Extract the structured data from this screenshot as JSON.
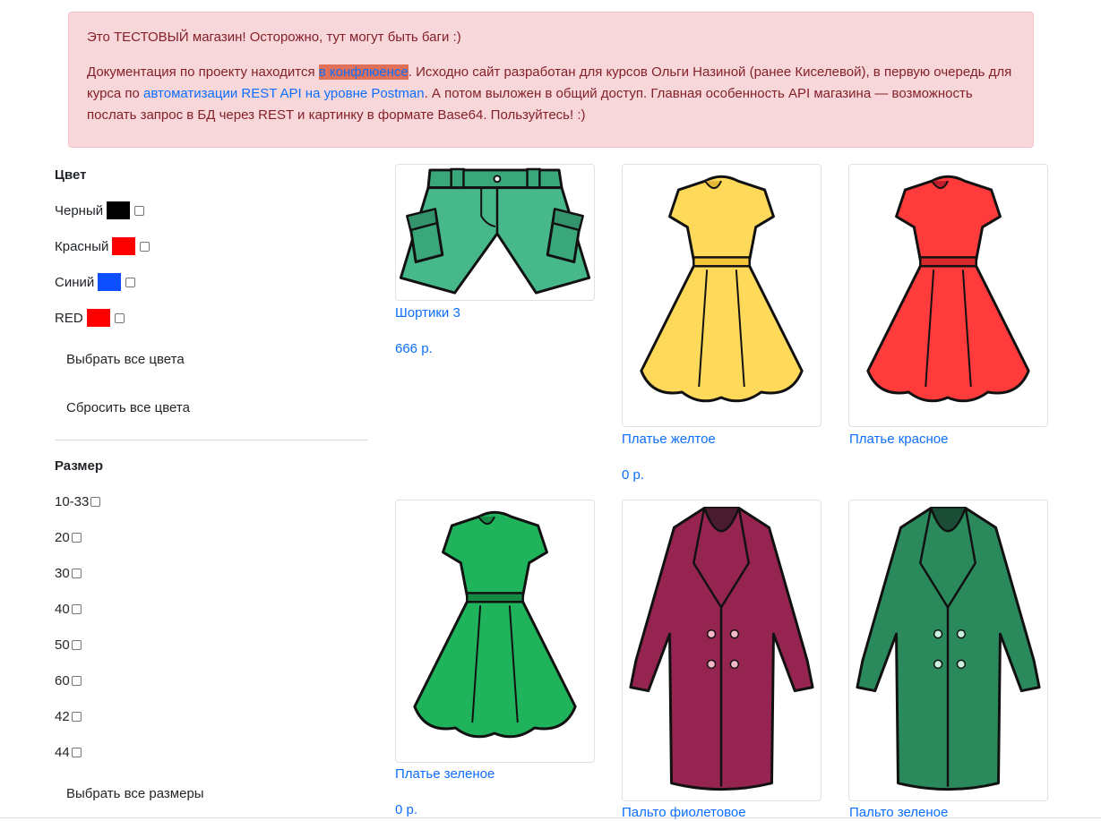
{
  "notice": {
    "line1": "Это ТЕСТОВЫЙ магазин! Осторожно, тут могут быть баги :)",
    "doc_before": "Документация по проекту находится ",
    "doc_link": "в конфлюенсе",
    "doc_middle1": ".  Исходно сайт разработан для курсов Ольги Назиной (ранее Киселевой), в первую очередь для курса по ",
    "doc_link2": "автоматизации REST API на уровне Postman",
    "doc_middle2": ". А потом выложен в общий доступ. Главная особенность API магазина — возможность послать запрос в БД через REST и картинку в формате Base64.  Пользуйтесь! :)"
  },
  "filters": {
    "color_heading": "Цвет",
    "colors": [
      {
        "label": "Черный",
        "swatch": "#000000"
      },
      {
        "label": "Красный",
        "swatch": "#ff0000"
      },
      {
        "label": "Синий",
        "swatch": "#0d4fff"
      },
      {
        "label": "RED",
        "swatch": "#ff0000"
      }
    ],
    "select_all_colors": "Выбрать все цвета",
    "reset_all_colors": "Сбросить все цвета",
    "size_heading": "Размер",
    "sizes": [
      "10-33",
      "20",
      "30",
      "40",
      "50",
      "60",
      "42",
      "44"
    ],
    "select_all_sizes": "Выбрать все размеры"
  },
  "products": [
    {
      "name": "Шортики 3",
      "price": "666 р.",
      "image": "shorts-icon",
      "color": "#47b88a"
    },
    {
      "name": "Платье желтое",
      "price": "0 р.",
      "image": "dress-icon",
      "color": "#ffd95a"
    },
    {
      "name": "Платье красное",
      "price": "",
      "image": "dress-icon",
      "color": "#ff3b3b"
    },
    {
      "name": "Платье зеленое",
      "price": "0 р.",
      "image": "dress-icon",
      "color": "#1fb45b"
    },
    {
      "name": "Пальто фиолетовое",
      "price": "",
      "image": "coat-icon",
      "color": "#962450"
    },
    {
      "name": "Пальто зеленое",
      "price": "",
      "image": "coat-icon",
      "color": "#2a8a5c"
    }
  ]
}
